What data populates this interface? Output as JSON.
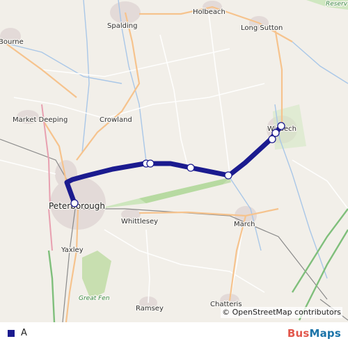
{
  "map": {
    "places": {
      "holbeach": "Holbeach",
      "spalding": "Spalding",
      "bourne": "Bourne",
      "long_sutton": "Long Sutton",
      "market_deeping": "Market Deeping",
      "crowland": "Crowland",
      "wisbech": "Wisbech",
      "peterborough": "Peterborough",
      "whittlesey": "Whittlesey",
      "march": "March",
      "yaxley": "Yaxley",
      "great_fen": "Great Fen",
      "ramsey": "Ramsey",
      "chatteris": "Chatteris",
      "reserve": "Reserv"
    },
    "attribution": "© OpenStreetMap contributors",
    "route_color": "#1b1b8f"
  },
  "legend": {
    "route_label": "A",
    "route_color": "#1b1b8f"
  },
  "brand": {
    "part1": "Bus",
    "part2": "Maps",
    "color1": "#e2574c",
    "color2": "#1a73a8"
  }
}
